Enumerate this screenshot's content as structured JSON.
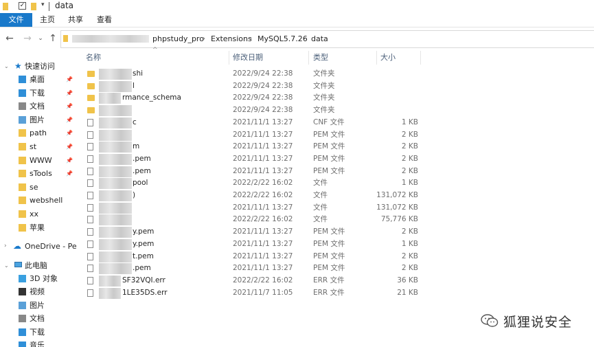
{
  "window": {
    "title": "data"
  },
  "ribbon": {
    "tabs": [
      "文件",
      "主页",
      "共享",
      "查看"
    ]
  },
  "address": {
    "crumbs": [
      "phpstudy_pro",
      "Extensions",
      "MySQL5.7.26",
      "data"
    ]
  },
  "sidebar": {
    "quick_access": "快速访问",
    "quick_items": [
      "桌面",
      "下载",
      "文档",
      "图片",
      "path",
      "st",
      "WWW",
      "sTools",
      "se",
      "webshell",
      "xx",
      "苹果"
    ],
    "onedrive": "OneDrive - Pers",
    "this_pc": "此电脑",
    "pc_items": [
      "3D 对象",
      "视频",
      "图片",
      "文档",
      "下载",
      "音乐"
    ]
  },
  "columns": {
    "name": "名称",
    "date": "修改日期",
    "type": "类型",
    "size": "大小"
  },
  "files": [
    {
      "name": "shi",
      "date": "2022/9/24 22:38",
      "type": "文件夹",
      "size": "",
      "kind": "folder"
    },
    {
      "name": "l",
      "date": "2022/9/24 22:38",
      "type": "文件夹",
      "size": "",
      "kind": "folder"
    },
    {
      "name": "rmance_schema",
      "date": "2022/9/24 22:38",
      "type": "文件夹",
      "size": "",
      "kind": "folder"
    },
    {
      "name": "",
      "date": "2022/9/24 22:38",
      "type": "文件夹",
      "size": "",
      "kind": "folder"
    },
    {
      "name": "c",
      "date": "2021/11/1 13:27",
      "type": "CNF 文件",
      "size": "1 KB",
      "kind": "file"
    },
    {
      "name": "",
      "date": "2021/11/1 13:27",
      "type": "PEM 文件",
      "size": "2 KB",
      "kind": "file"
    },
    {
      "name": "m",
      "date": "2021/11/1 13:27",
      "type": "PEM 文件",
      "size": "2 KB",
      "kind": "file"
    },
    {
      "name": ".pem",
      "date": "2021/11/1 13:27",
      "type": "PEM 文件",
      "size": "2 KB",
      "kind": "file"
    },
    {
      "name": ".pem",
      "date": "2021/11/1 13:27",
      "type": "PEM 文件",
      "size": "2 KB",
      "kind": "file"
    },
    {
      "name": "pool",
      "date": "2022/2/22 16:02",
      "type": "文件",
      "size": "1 KB",
      "kind": "file"
    },
    {
      "name": ")",
      "date": "2022/2/22 16:02",
      "type": "文件",
      "size": "131,072 KB",
      "kind": "file"
    },
    {
      "name": "",
      "date": "2021/11/1 13:27",
      "type": "文件",
      "size": "131,072 KB",
      "kind": "file"
    },
    {
      "name": "",
      "date": "2022/2/22 16:02",
      "type": "文件",
      "size": "75,776 KB",
      "kind": "file"
    },
    {
      "name": "y.pem",
      "date": "2021/11/1 13:27",
      "type": "PEM 文件",
      "size": "2 KB",
      "kind": "file"
    },
    {
      "name": "y.pem",
      "date": "2021/11/1 13:27",
      "type": "PEM 文件",
      "size": "1 KB",
      "kind": "file"
    },
    {
      "name": "t.pem",
      "date": "2021/11/1 13:27",
      "type": "PEM 文件",
      "size": "2 KB",
      "kind": "file"
    },
    {
      "name": ".pem",
      "date": "2021/11/1 13:27",
      "type": "PEM 文件",
      "size": "2 KB",
      "kind": "file"
    },
    {
      "name": "SF32VQI.err",
      "date": "2022/2/22 16:02",
      "type": "ERR 文件",
      "size": "36 KB",
      "kind": "file"
    },
    {
      "name": "1LE35DS.err",
      "date": "2021/11/7 11:05",
      "type": "ERR 文件",
      "size": "21 KB",
      "kind": "file"
    }
  ],
  "watermark": {
    "text": "狐狸说安全"
  },
  "colors": {
    "accent": "#1979ca",
    "folder": "#f0c34a"
  }
}
